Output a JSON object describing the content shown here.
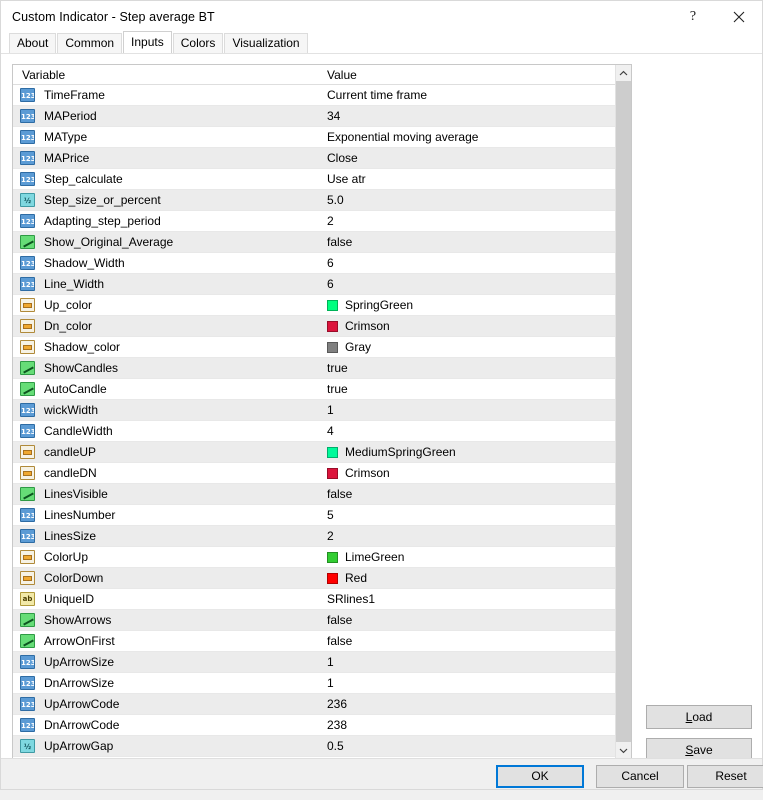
{
  "window": {
    "title": "Custom Indicator - Step average BT",
    "help_icon": "question-mark-icon",
    "close_icon": "close-icon"
  },
  "tabs": [
    {
      "label": "About",
      "active": false
    },
    {
      "label": "Common",
      "active": false
    },
    {
      "label": "Inputs",
      "active": true
    },
    {
      "label": "Colors",
      "active": false
    },
    {
      "label": "Visualization",
      "active": false
    }
  ],
  "grid": {
    "headers": {
      "variable": "Variable",
      "value": "Value"
    },
    "rows": [
      {
        "type": "int",
        "name": "TimeFrame",
        "value": "Current time frame"
      },
      {
        "type": "int",
        "name": "MAPeriod",
        "value": "34"
      },
      {
        "type": "int",
        "name": "MAType",
        "value": "Exponential moving average"
      },
      {
        "type": "int",
        "name": "MAPrice",
        "value": "Close"
      },
      {
        "type": "int",
        "name": "Step_calculate",
        "value": "Use atr"
      },
      {
        "type": "double",
        "name": "Step_size_or_percent",
        "value": "5.0"
      },
      {
        "type": "int",
        "name": "Adapting_step_period",
        "value": "2"
      },
      {
        "type": "bool",
        "name": "Show_Original_Average",
        "value": "false"
      },
      {
        "type": "int",
        "name": "Shadow_Width",
        "value": "6"
      },
      {
        "type": "int",
        "name": "Line_Width",
        "value": "6"
      },
      {
        "type": "color",
        "name": "Up_color",
        "value": "SpringGreen",
        "swatch": "#00FF7F"
      },
      {
        "type": "color",
        "name": "Dn_color",
        "value": "Crimson",
        "swatch": "#DC143C"
      },
      {
        "type": "color",
        "name": "Shadow_color",
        "value": "Gray",
        "swatch": "#808080"
      },
      {
        "type": "bool",
        "name": "ShowCandles",
        "value": "true"
      },
      {
        "type": "bool",
        "name": "AutoCandle",
        "value": "true"
      },
      {
        "type": "int",
        "name": "wickWidth",
        "value": "1"
      },
      {
        "type": "int",
        "name": "CandleWidth",
        "value": "4"
      },
      {
        "type": "color",
        "name": "candleUP",
        "value": "MediumSpringGreen",
        "swatch": "#00FA9A"
      },
      {
        "type": "color",
        "name": "candleDN",
        "value": "Crimson",
        "swatch": "#DC143C"
      },
      {
        "type": "bool",
        "name": "LinesVisible",
        "value": "false"
      },
      {
        "type": "int",
        "name": "LinesNumber",
        "value": "5"
      },
      {
        "type": "int",
        "name": "LinesSize",
        "value": "2"
      },
      {
        "type": "color",
        "name": "ColorUp",
        "value": "LimeGreen",
        "swatch": "#32CD32"
      },
      {
        "type": "color",
        "name": "ColorDown",
        "value": "Red",
        "swatch": "#FF0000"
      },
      {
        "type": "string",
        "name": "UniqueID",
        "value": "SRlines1"
      },
      {
        "type": "bool",
        "name": "ShowArrows",
        "value": "false"
      },
      {
        "type": "bool",
        "name": "ArrowOnFirst",
        "value": "false"
      },
      {
        "type": "int",
        "name": "UpArrowSize",
        "value": "1"
      },
      {
        "type": "int",
        "name": "DnArrowSize",
        "value": "1"
      },
      {
        "type": "int",
        "name": "UpArrowCode",
        "value": "236"
      },
      {
        "type": "int",
        "name": "DnArrowCode",
        "value": "238"
      },
      {
        "type": "double",
        "name": "UpArrowGap",
        "value": "0.5"
      }
    ],
    "icon_glyphs": {
      "int": "123",
      "double": "½",
      "string": "ab"
    }
  },
  "side_buttons": {
    "load": {
      "prefix": "",
      "accel": "L",
      "suffix": "oad"
    },
    "save": {
      "prefix": "",
      "accel": "S",
      "suffix": "ave"
    }
  },
  "footer_buttons": {
    "ok": "OK",
    "cancel": "Cancel",
    "reset": "Reset"
  },
  "colors": {
    "accent": "#0078D7",
    "row_alt": "#ECECEC",
    "button_face": "#E1E1E1"
  }
}
